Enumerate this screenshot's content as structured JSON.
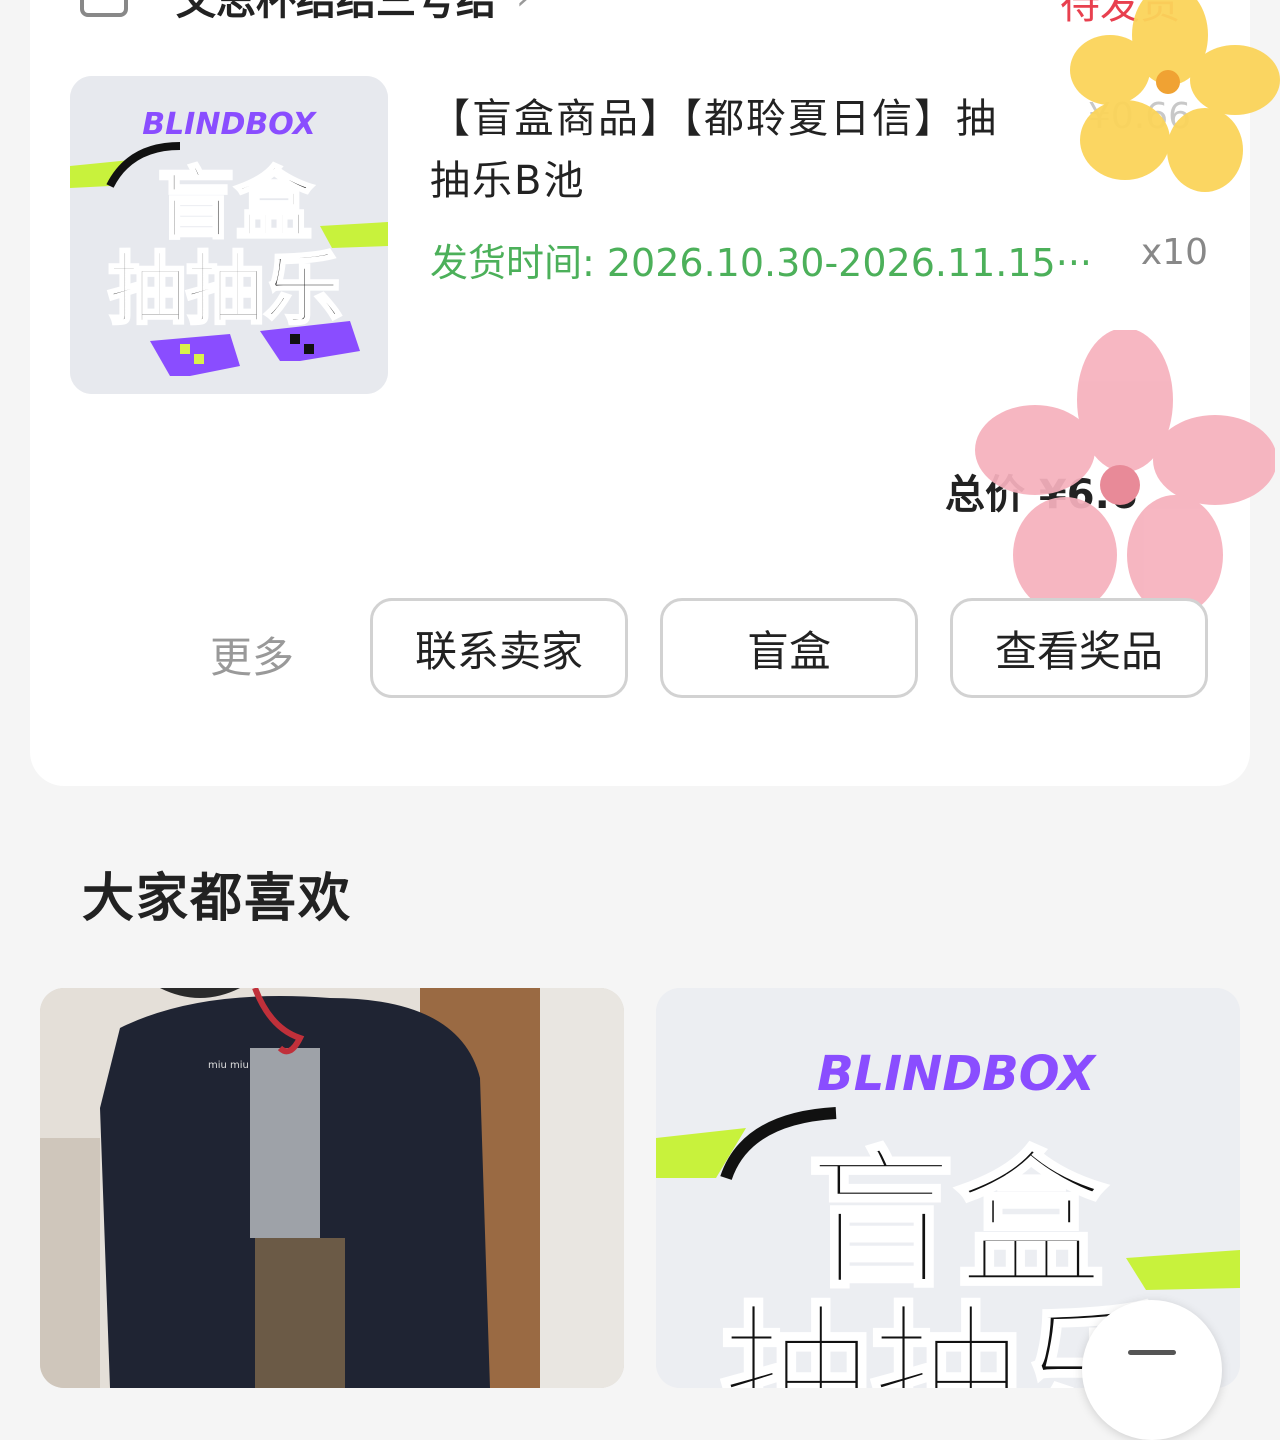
{
  "order": {
    "shop_name": "文思杯结结三号结",
    "shop_chevron": "›",
    "status": "待发货",
    "product": {
      "thumb_brand": "BLINDBOX",
      "thumb_line1": "盲盒",
      "thumb_line2": "抽抽乐",
      "title": "【盲盒商品】【都聆夏日信】抽抽乐B池",
      "price": "¥0.66",
      "shipping": "发货时间: 2026.10.30-2026.11.15···",
      "quantity": "x10"
    },
    "total": "总价 ¥6.6"
  },
  "actions": {
    "more": "更多",
    "contact_seller": "联系卖家",
    "blind_box": "盲盒",
    "view_prizes": "查看奖品"
  },
  "recommend": {
    "title": "大家都喜欢",
    "items": [
      {
        "jacket_logo": "miu miu"
      },
      {
        "brand": "BLINDBOX",
        "line1": "盲盒",
        "line2": "抽抽乐"
      }
    ]
  },
  "colors": {
    "status": "#e8404f",
    "shipping": "#4cb05a",
    "brand_purple": "#8a4dff",
    "accent_green": "#c8f23c"
  }
}
